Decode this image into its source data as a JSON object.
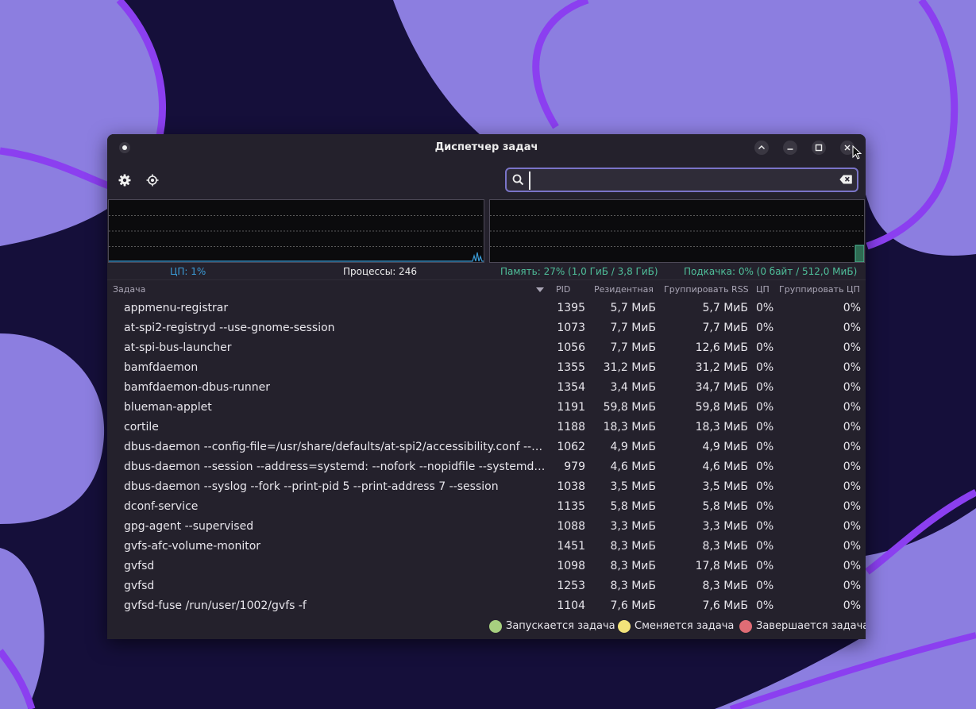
{
  "window": {
    "title": "Диспетчер задач"
  },
  "search": {
    "placeholder": "",
    "value": ""
  },
  "stats": {
    "cpu": "ЦП: 1%",
    "processes": "Процессы: 246",
    "memory": "Память: 27% (1,0 ГиБ / 3,8 ГиБ)",
    "swap": "Подкачка: 0% (0 байт / 512,0 МиБ)"
  },
  "columns": {
    "task": "Задача",
    "pid": "PID",
    "resident": "Резидентная",
    "group_rss": "Группировать RSS",
    "cpu": "ЦП",
    "group_cpu": "Группировать ЦП"
  },
  "rows": [
    {
      "task": "appmenu-registrar",
      "pid": "1395",
      "resident": "5,7 МиБ",
      "group_rss": "5,7 МиБ",
      "cpu": "0%",
      "group_cpu": "0%"
    },
    {
      "task": "at-spi2-registryd --use-gnome-session",
      "pid": "1073",
      "resident": "7,7 МиБ",
      "group_rss": "7,7 МиБ",
      "cpu": "0%",
      "group_cpu": "0%"
    },
    {
      "task": "at-spi-bus-launcher",
      "pid": "1056",
      "resident": "7,7 МиБ",
      "group_rss": "12,6 МиБ",
      "cpu": "0%",
      "group_cpu": "0%"
    },
    {
      "task": "bamfdaemon",
      "pid": "1355",
      "resident": "31,2 МиБ",
      "group_rss": "31,2 МиБ",
      "cpu": "0%",
      "group_cpu": "0%"
    },
    {
      "task": "bamfdaemon-dbus-runner",
      "pid": "1354",
      "resident": "3,4 МиБ",
      "group_rss": "34,7 МиБ",
      "cpu": "0%",
      "group_cpu": "0%"
    },
    {
      "task": "blueman-applet",
      "pid": "1191",
      "resident": "59,8 МиБ",
      "group_rss": "59,8 МиБ",
      "cpu": "0%",
      "group_cpu": "0%"
    },
    {
      "task": "cortile",
      "pid": "1188",
      "resident": "18,3 МиБ",
      "group_rss": "18,3 МиБ",
      "cpu": "0%",
      "group_cpu": "0%"
    },
    {
      "task": "dbus-daemon --config-file=/usr/share/defaults/at-spi2/accessibility.conf --nofork --pri…",
      "pid": "1062",
      "resident": "4,9 МиБ",
      "group_rss": "4,9 МиБ",
      "cpu": "0%",
      "group_cpu": "0%"
    },
    {
      "task": "dbus-daemon --session --address=systemd: --nofork --nopidfile --systemd-activation --…",
      "pid": "979",
      "resident": "4,6 МиБ",
      "group_rss": "4,6 МиБ",
      "cpu": "0%",
      "group_cpu": "0%"
    },
    {
      "task": "dbus-daemon --syslog --fork --print-pid 5 --print-address 7 --session",
      "pid": "1038",
      "resident": "3,5 МиБ",
      "group_rss": "3,5 МиБ",
      "cpu": "0%",
      "group_cpu": "0%"
    },
    {
      "task": "dconf-service",
      "pid": "1135",
      "resident": "5,8 МиБ",
      "group_rss": "5,8 МиБ",
      "cpu": "0%",
      "group_cpu": "0%"
    },
    {
      "task": "gpg-agent --supervised",
      "pid": "1088",
      "resident": "3,3 МиБ",
      "group_rss": "3,3 МиБ",
      "cpu": "0%",
      "group_cpu": "0%"
    },
    {
      "task": "gvfs-afc-volume-monitor",
      "pid": "1451",
      "resident": "8,3 МиБ",
      "group_rss": "8,3 МиБ",
      "cpu": "0%",
      "group_cpu": "0%"
    },
    {
      "task": "gvfsd",
      "pid": "1098",
      "resident": "8,3 МиБ",
      "group_rss": "17,8 МиБ",
      "cpu": "0%",
      "group_cpu": "0%"
    },
    {
      "task": "gvfsd",
      "pid": "1253",
      "resident": "8,3 МиБ",
      "group_rss": "8,3 МиБ",
      "cpu": "0%",
      "group_cpu": "0%"
    },
    {
      "task": "gvfsd-fuse /run/user/1002/gvfs -f",
      "pid": "1104",
      "resident": "7,6 МиБ",
      "group_rss": "7,6 МиБ",
      "cpu": "0%",
      "group_cpu": "0%"
    }
  ],
  "legend": {
    "starting": "Запускается задача",
    "changing": "Сменяется задача",
    "ending": "Завершается задача"
  },
  "colors": {
    "cpu": "#3b9bd6",
    "memory": "#4fbf9a",
    "starting": "#a7d07f",
    "changing": "#f3e37a",
    "ending": "#e06c75"
  },
  "icons": [
    "settings-gear-icon",
    "target-crosshair-icon",
    "search-icon",
    "clear-text-icon",
    "window-menu-icon",
    "window-roll-up-icon",
    "minimize-icon",
    "maximize-icon",
    "close-icon"
  ]
}
